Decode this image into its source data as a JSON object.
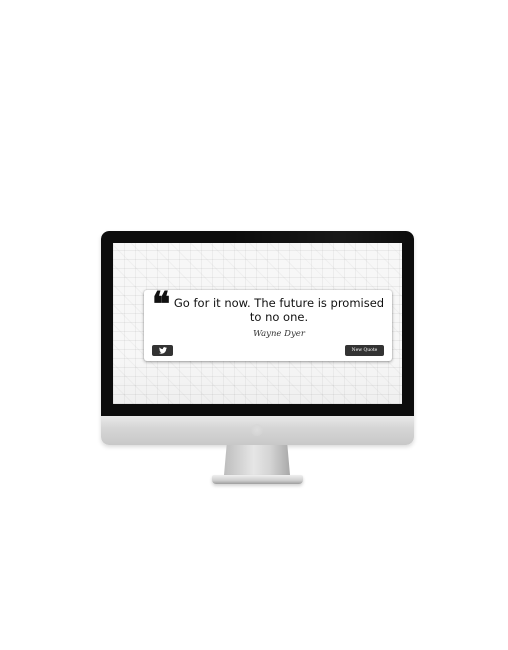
{
  "quote": {
    "text": "Go for it now. The future is promised to no one.",
    "author": "Wayne Dyer",
    "mark": "❝"
  },
  "buttons": {
    "tweet_icon": "twitter-icon",
    "new_quote_label": "New Quote"
  },
  "colors": {
    "button_bg": "#333333",
    "card_bg": "#ffffff",
    "bezel": "#0c0c0c"
  }
}
